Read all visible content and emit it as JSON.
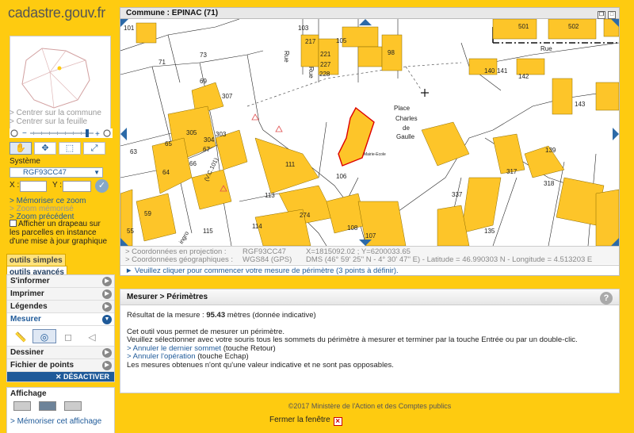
{
  "brand": {
    "logo": "cadastre.gouv.fr"
  },
  "left": {
    "nav_links": [
      "> Centrer sur la commune",
      "> Centrer sur la feuille"
    ],
    "systeme_label": "Système",
    "systeme_value": "RGF93CC47",
    "x_label": "X :",
    "y_label": "Y :",
    "zoom_links": [
      "> Mémoriser ce zoom",
      "> Zoom mémorisé",
      "> Zoom précédent"
    ],
    "drapeau_text": "Afficher un drapeau sur les parcelles en instance d'une mise à jour graphique",
    "tabs": [
      "outils simples",
      "outils avancés"
    ],
    "menu": [
      "S'informer",
      "Imprimer",
      "Légendes",
      "Mesurer",
      "Dessiner",
      "Fichier de points"
    ],
    "desactiver": "DÉSACTIVER",
    "affichage_title": "Affichage",
    "memoriser_affichage": "> Mémoriser cet affichage"
  },
  "map": {
    "title": "Commune : EPINAC (71)",
    "street_labels": [
      "Rue",
      "Rue",
      "Rue",
      "(V.C.101)",
      "Place",
      "Charles",
      "de",
      "Gaulle",
      "ingro"
    ],
    "parcels": [
      "101",
      "103",
      "105",
      "217",
      "221",
      "227",
      "228",
      "98",
      "501",
      "502",
      "71",
      "73",
      "69",
      "307",
      "140",
      "141",
      "142",
      "143",
      "304",
      "305",
      "303",
      "65",
      "67",
      "66",
      "63",
      "64",
      "111",
      "106",
      "113",
      "139",
      "317",
      "318",
      "337",
      "59",
      "274",
      "114",
      "115",
      "108",
      "107",
      "135",
      "55"
    ],
    "mairie_label": "Mairie-Ecole",
    "coords": {
      "proj_label": "> Coordonnées en projection :",
      "proj_system": "RGF93CC47",
      "proj_value": "X=1815092.02 ; Y=6200033.65",
      "geo_label": "> Coordonnées géographiques :",
      "geo_system": "WGS84 (GPS)",
      "geo_value": "DMS (46° 59' 25'' N - 4° 30' 47'' E) - Latitude = 46.990303 N - Longitude = 4.513203 E"
    },
    "hint": "► Veuillez cliquer pour commencer votre mesure de périmètre (3 points à définir)."
  },
  "measure": {
    "title": "Mesurer > Périmètres",
    "result_prefix": "Résultat de la mesure : ",
    "result_value": "95.43",
    "result_suffix": " mètres (donnée indicative)",
    "lines": [
      "Cet outil vous permet de mesurer un périmètre.",
      "Veuillez sélectionner avec votre souris tous les sommets du périmètre à mesurer et terminer par la touche Entrée ou par un double-clic."
    ],
    "link1": "> Annuler le dernier sommet",
    "link1_suffix": " (touche Retour)",
    "link2": "> Annuler l'opération",
    "link2_suffix": " (touche Echap)",
    "note": "Les mesures obtenues n'ont qu'une valeur indicative et ne sont pas opposables."
  },
  "footer": {
    "copyright": "©2017 Ministère de l'Action et des Comptes publics",
    "close_label": "Fermer la fenêtre"
  },
  "colors": {
    "accent": "#fecb10",
    "building": "#fdc529",
    "link": "#1f5a99",
    "selection": "#dd0000"
  }
}
